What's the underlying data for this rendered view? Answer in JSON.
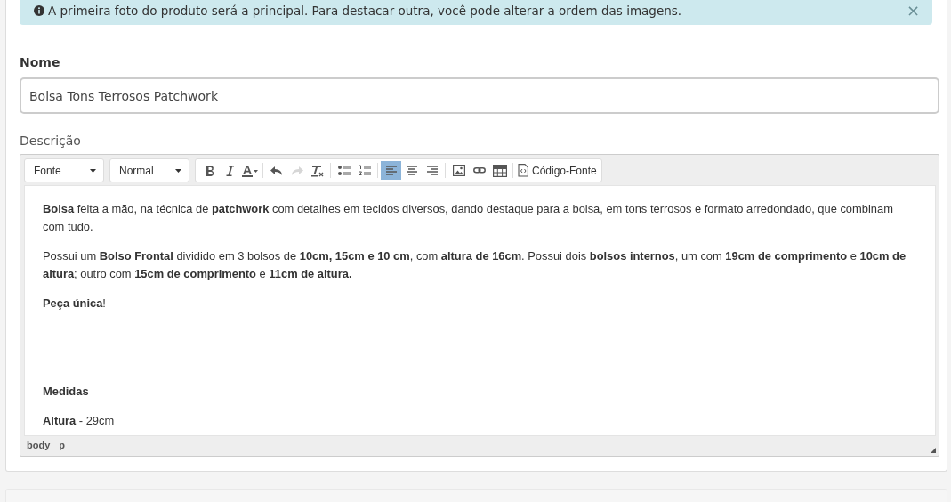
{
  "alert": {
    "text": "A primeira foto do produto será a principal. Para destacar outra, você pode alterar a ordem das imagens.",
    "close": "×"
  },
  "name_field": {
    "label": "Nome",
    "value": "Bolsa Tons Terrosos Patchwork"
  },
  "description": {
    "label": "Descrição",
    "toolbar": {
      "dropdowns": [
        {
          "label": "Fonte"
        },
        {
          "label": "Normal"
        }
      ],
      "groups": [
        [
          {
            "kind": "bold",
            "selected": false,
            "disabled": false
          },
          {
            "kind": "italic",
            "selected": false,
            "disabled": false
          },
          {
            "kind": "text-color",
            "selected": false,
            "disabled": false
          }
        ],
        [
          {
            "kind": "undo",
            "selected": false,
            "disabled": false
          },
          {
            "kind": "redo",
            "selected": false,
            "disabled": true
          },
          {
            "kind": "clear-format",
            "selected": false,
            "disabled": false
          }
        ],
        [
          {
            "kind": "bullet-list",
            "selected": false,
            "disabled": false
          },
          {
            "kind": "number-list",
            "selected": false,
            "disabled": false
          }
        ],
        [
          {
            "kind": "align-left",
            "selected": true,
            "disabled": false
          },
          {
            "kind": "align-center",
            "selected": false,
            "disabled": false
          },
          {
            "kind": "align-right",
            "selected": false,
            "disabled": false
          }
        ],
        [
          {
            "kind": "image",
            "selected": false,
            "disabled": false
          },
          {
            "kind": "link",
            "selected": false,
            "disabled": false
          },
          {
            "kind": "table",
            "selected": false,
            "disabled": false
          }
        ],
        [
          {
            "kind": "source",
            "label": "Código-Fonte",
            "selected": false,
            "disabled": false
          }
        ]
      ]
    },
    "paragraphs": [
      {
        "kind": "text",
        "text": "**Bolsa** feita a mão, na técnica de **patchwork** com detalhes em tecidos diversos, dando destaque para a bolsa, em tons terrosos e formato arredondado, que combinam com tudo."
      },
      {
        "kind": "text",
        "text": "Possui um **Bolso Frontal** dividido em 3 bolsos de **10cm, 15cm e 10 cm**, com **altura de 16cm**. Possui dois **bolsos internos**, um com **19cm de comprimento** e **10cm de altura**; outro com **15cm de comprimento** e **11cm de altura.**"
      },
      {
        "kind": "text",
        "text": "**Peça única**!"
      },
      {
        "kind": "blank"
      },
      {
        "kind": "blank"
      },
      {
        "kind": "text",
        "text": "**Medidas**"
      },
      {
        "kind": "text",
        "text": "**Altura** - 29cm"
      }
    ],
    "path": [
      "body",
      "p"
    ]
  }
}
